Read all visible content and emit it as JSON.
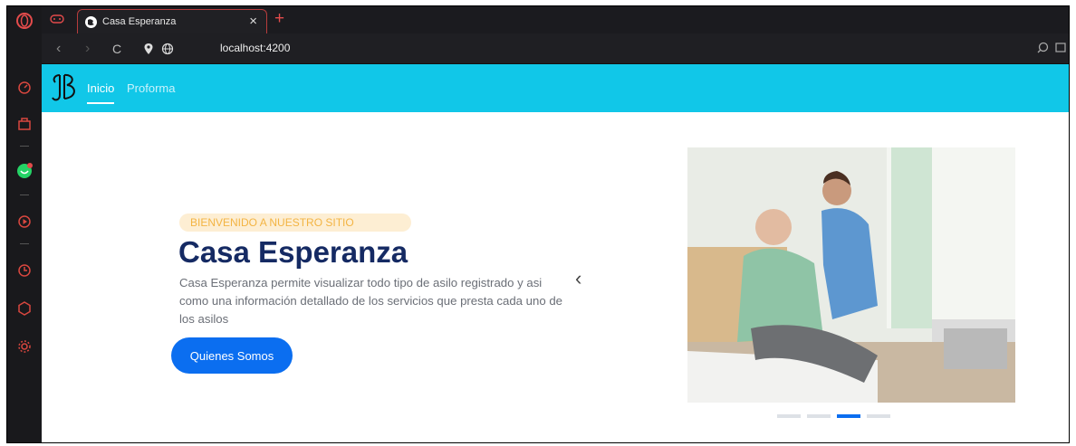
{
  "browser": {
    "tab_title": "Casa Esperanza",
    "tab_close": "×",
    "new_tab": "+",
    "url": "localhost:4200",
    "nav": {
      "back": "‹",
      "forward": "›",
      "reload": "C"
    }
  },
  "site": {
    "nav": {
      "inicio": "Inicio",
      "proforma": "Proforma"
    },
    "hero": {
      "badge": "BIENVENIDO A NUESTRO SITIO",
      "title": "Casa Esperanza",
      "description": "Casa Esperanza permite visualizar todo tipo de asilo registrado y asi como una información detallado de los servicios que presta cada uno de los asilos",
      "button": "Quienes Somos",
      "prev": "‹"
    },
    "carousel": {
      "slides": 4,
      "active_index": 2
    }
  },
  "colors": {
    "navbar": "#11c7e8",
    "heading": "#152a63",
    "button": "#0b6ef0",
    "badge_bg": "#fdeed3",
    "badge_text": "#f3b443"
  }
}
